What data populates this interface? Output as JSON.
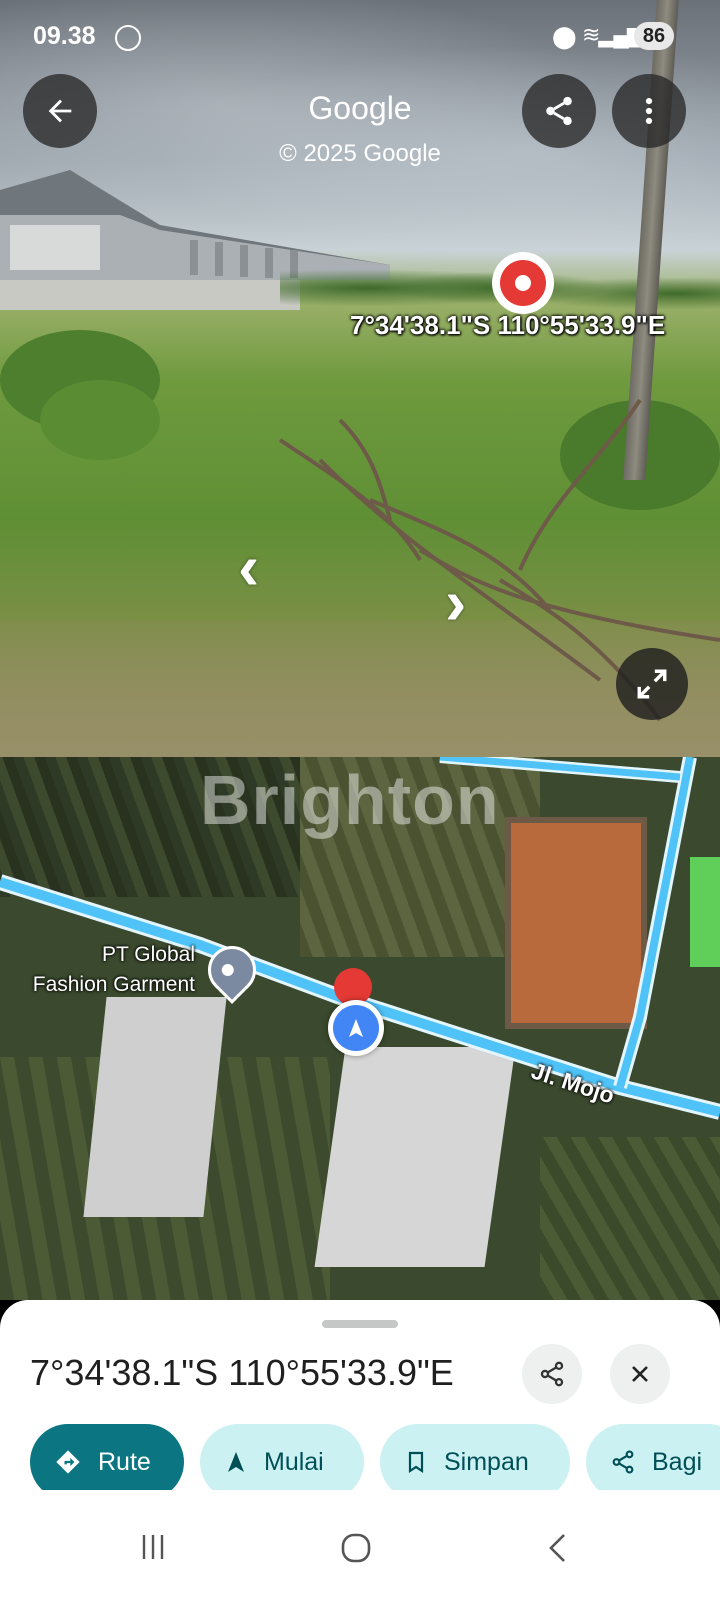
{
  "status_bar": {
    "time": "09.38",
    "battery": "86"
  },
  "street_view": {
    "title": "Google",
    "copyright": "© 2025 Google",
    "coordinates": "7°34'38.1\"S 110°55'33.9\"E",
    "icons": {
      "back": "arrow-back-icon",
      "share": "share-icon",
      "more": "more-vert-icon",
      "expand": "expand-icon"
    }
  },
  "map": {
    "watermark": "Brighton",
    "place_label_line1": "PT Global",
    "place_label_line2": "Fashion Garment",
    "road_label": "Jl. Mojo",
    "colors": {
      "road": "#4fc3f7",
      "road_border": "#e3f6ff"
    }
  },
  "sheet": {
    "coordinates": "7°34'38.1\"S 110°55'33.9\"E",
    "chips": [
      {
        "label": "Rute",
        "icon": "directions-icon"
      },
      {
        "label": "Mulai",
        "icon": "navigation-icon"
      },
      {
        "label": "Simpan",
        "icon": "bookmark-icon"
      },
      {
        "label": "Bagi",
        "icon": "share-icon"
      }
    ],
    "colors": {
      "primary_chip": "#0b7681",
      "secondary_chip": "#ccf1f3"
    }
  }
}
